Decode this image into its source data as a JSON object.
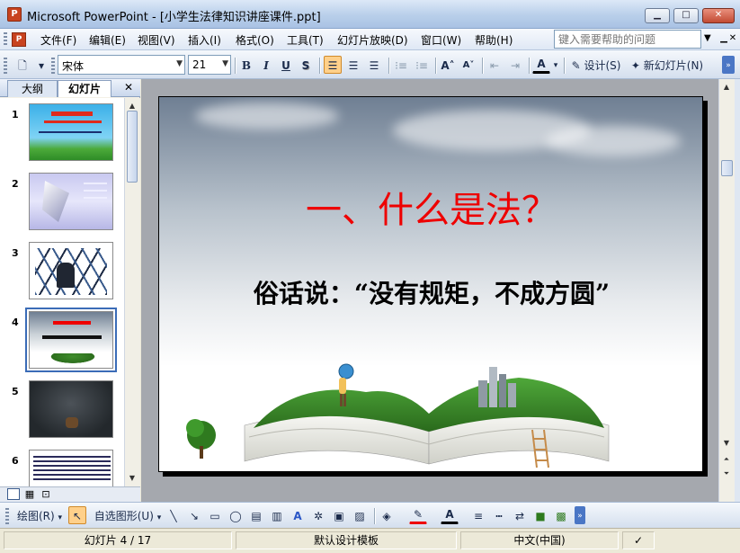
{
  "window": {
    "title": "Microsoft PowerPoint - [小学生法律知识讲座课件.ppt]",
    "minimize": "▁",
    "maximize": "□",
    "close": "✕",
    "app_icon": "powerpoint-icon"
  },
  "menubar": {
    "items": [
      "文件(F)",
      "编辑(E)",
      "视图(V)",
      "插入(I)",
      "格式(O)",
      "工具(T)",
      "幻灯片放映(D)",
      "窗口(W)",
      "帮助(H)"
    ],
    "help_placeholder": "键入需要帮助的问题",
    "doc_minimize": "▁",
    "doc_restore": "▫",
    "doc_close": "✕"
  },
  "toolbar": {
    "font_name": "宋体",
    "font_size": "21",
    "bold": "B",
    "italic": "I",
    "underline": "U",
    "shadow": "S",
    "design_label": "设计(S)",
    "new_slide_label": "新幻灯片(N)",
    "active_button": "align-left"
  },
  "left_pane": {
    "tabs": [
      "大纲",
      "幻灯片"
    ],
    "active_tab": "幻灯片",
    "close": "✕",
    "thumbnails": [
      {
        "number": "1"
      },
      {
        "number": "2"
      },
      {
        "number": "3"
      },
      {
        "number": "4",
        "selected": true
      },
      {
        "number": "5"
      },
      {
        "number": "6"
      }
    ]
  },
  "slide": {
    "title": "一、什么是法？",
    "body": "俗话说：“没有规矩，不成方圆”",
    "title_color": "#e00000",
    "body_color": "#000000"
  },
  "drawbar": {
    "draw_label": "绘图(R)",
    "autoshapes_label": "自选图形(U)"
  },
  "statusbar": {
    "slide_position": "幻灯片 4 / 17",
    "template": "默认设计模板",
    "language": "中文(中国)"
  }
}
